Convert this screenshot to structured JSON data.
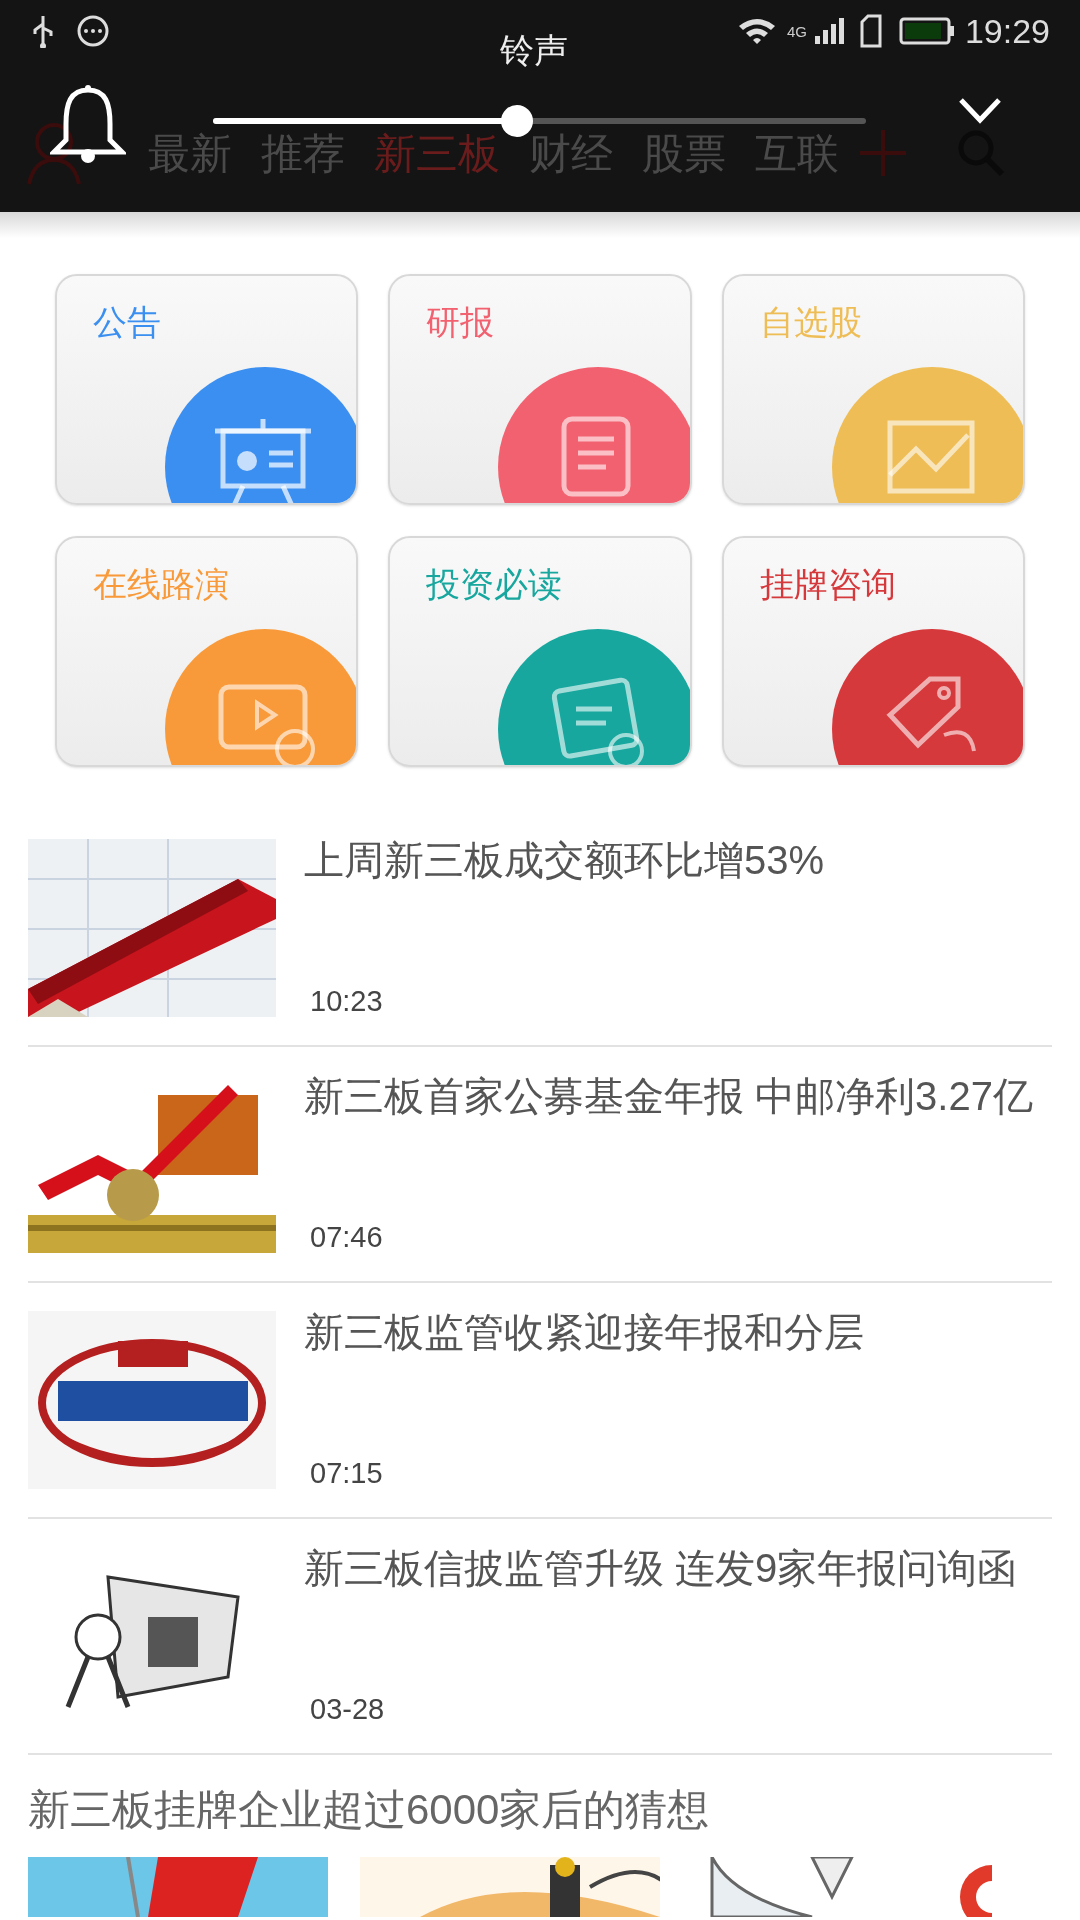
{
  "status_bar": {
    "time": "19:29",
    "network": "4G"
  },
  "volume_panel": {
    "title": "铃声",
    "level": 0.466
  },
  "nav_tabs": [
    {
      "label": "最新",
      "selected": false
    },
    {
      "label": "推荐",
      "selected": false
    },
    {
      "label": "新三板",
      "selected": true
    },
    {
      "label": "财经",
      "selected": false
    },
    {
      "label": "股票",
      "selected": false
    },
    {
      "label": "互联",
      "selected": false
    }
  ],
  "categories": [
    {
      "label": "公告",
      "color": "#3b8ff0",
      "kind": "board"
    },
    {
      "label": "研报",
      "color": "#f2616f",
      "kind": "doc"
    },
    {
      "label": "自选股",
      "color": "#eebd55",
      "kind": "chart"
    },
    {
      "label": "在线路演",
      "color": "#f99a3a",
      "kind": "video"
    },
    {
      "label": "投资必读",
      "color": "#17a79e",
      "kind": "clip"
    },
    {
      "label": "挂牌咨询",
      "color": "#d6393c",
      "kind": "tag"
    }
  ],
  "news": [
    {
      "title": "上周新三板成交额环比增53%",
      "time": "10:23"
    },
    {
      "title": "新三板首家公募基金年报 中邮净利3.27亿",
      "time": "07:46"
    },
    {
      "title": "新三板监管收紧迎接年报和分层",
      "time": "07:15"
    },
    {
      "title": "新三板信披监管升级 连发9家年报问询函",
      "time": "03-28"
    }
  ],
  "feature": {
    "title": "新三板挂牌企业超过6000家后的猜想"
  }
}
